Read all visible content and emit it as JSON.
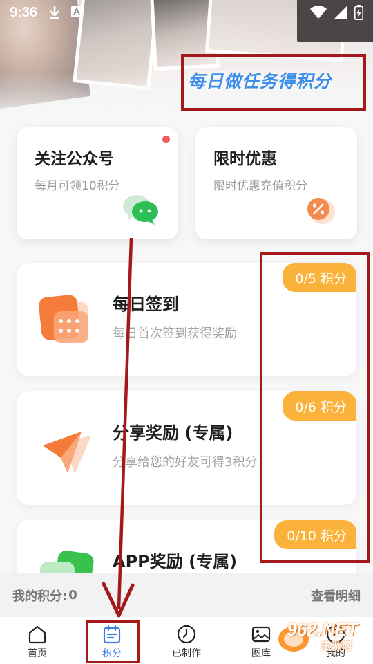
{
  "status_bar": {
    "time": "9:36"
  },
  "banner": {
    "title": "每日做任务得积分"
  },
  "top_cards": [
    {
      "title": "关注公众号",
      "subtitle": "每月可领10积分",
      "icon": "wechat-icon",
      "has_dot": true
    },
    {
      "title": "限时优惠",
      "subtitle": "限时优惠充值积分",
      "icon": "discount-icon",
      "has_dot": false
    }
  ],
  "tasks": [
    {
      "title": "每日签到",
      "desc": "每日首次签到获得奖励",
      "badge": "0/5 积分",
      "icon": "calendar-icon"
    },
    {
      "title": "分享奖励 (专属)",
      "desc": "分享给您的好友可得3积分",
      "badge": "0/6 积分",
      "icon": "paper-plane-icon"
    },
    {
      "title": "APP奖励 (专属)",
      "desc": "",
      "badge": "0/10 积分",
      "icon": "app-reward-icon"
    }
  ],
  "points_bar": {
    "label": "我的积分:",
    "value": "0",
    "detail_link": "查看明细"
  },
  "bottom_nav": [
    {
      "label": "首页",
      "icon": "home-icon",
      "active": false
    },
    {
      "label": "积分",
      "icon": "points-icon",
      "active": true
    },
    {
      "label": "已制作",
      "icon": "clock-icon",
      "active": false
    },
    {
      "label": "图库",
      "icon": "gallery-icon",
      "active": false
    },
    {
      "label": "我的",
      "icon": "profile-icon",
      "active": false
    }
  ],
  "watermark": {
    "text": "962.NET",
    "sub": "乐游网"
  },
  "colors": {
    "accent": "#3a7ee6",
    "badge": "#fbb23b",
    "annotation": "#a41a1a",
    "banner_text": "#3c8fe8"
  }
}
